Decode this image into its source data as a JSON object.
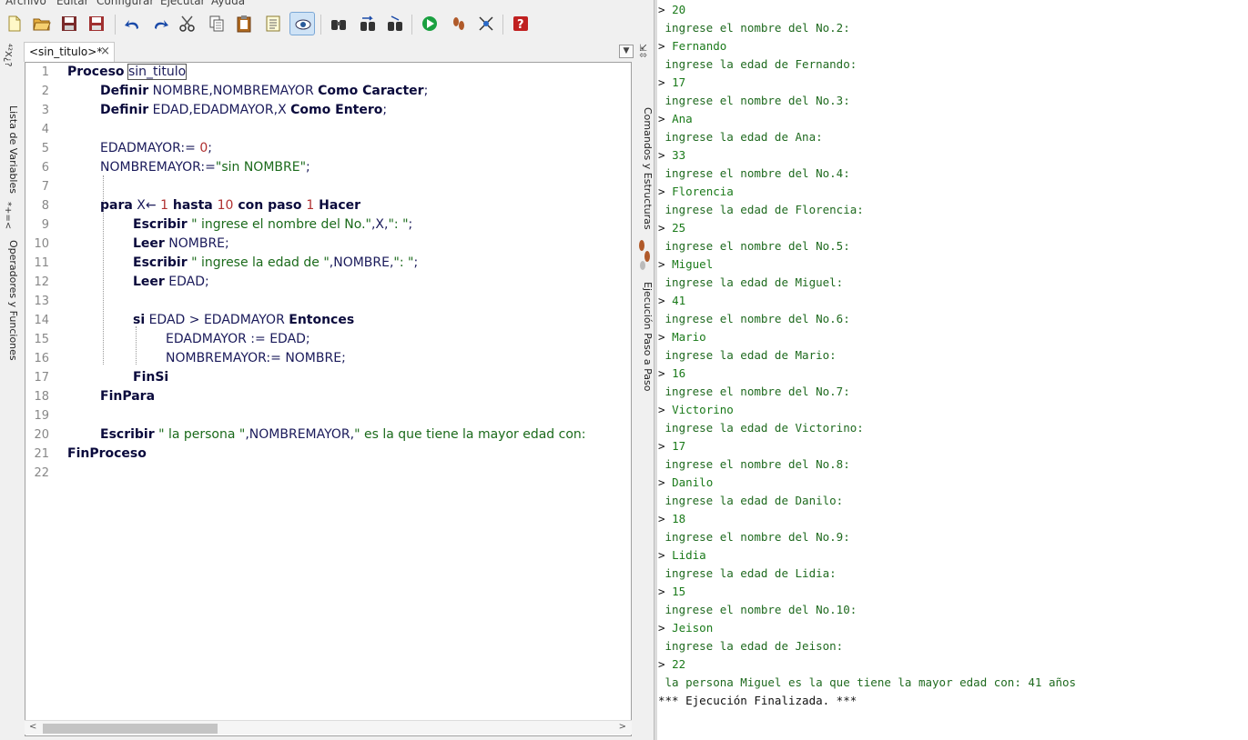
{
  "menu": [
    "Archivo",
    "Editar",
    "Configurar",
    "Ejecutar",
    "Ayuda"
  ],
  "toolbar": {
    "buttons": [
      "new-file-icon",
      "open-folder-icon",
      "save-icon",
      "save-as-icon",
      "undo-icon",
      "redo-icon",
      "cut-icon",
      "copy-icon",
      "paste-icon",
      "select-all-icon",
      "indent-icon",
      "find-icon",
      "find-next-icon",
      "replace-icon",
      "run-icon",
      "step-icon",
      "flowchart-icon",
      "help-icon"
    ]
  },
  "left_rail": {
    "variables_tab": "Lista de Variables",
    "operators_tab": "Operadores y Funciones"
  },
  "right_rail": {
    "commands_tab": "Comandos y Estructuras",
    "step_tab": "Ejecución Paso a Paso"
  },
  "editor": {
    "tab_label": "<sin_titulo>*",
    "tab_close": "×",
    "lines": [
      {
        "n": "1"
      },
      {
        "n": "2"
      },
      {
        "n": "3"
      },
      {
        "n": "4"
      },
      {
        "n": "5"
      },
      {
        "n": "6"
      },
      {
        "n": "7"
      },
      {
        "n": "8"
      },
      {
        "n": "9"
      },
      {
        "n": "10"
      },
      {
        "n": "11"
      },
      {
        "n": "12"
      },
      {
        "n": "13"
      },
      {
        "n": "14"
      },
      {
        "n": "15"
      },
      {
        "n": "16"
      },
      {
        "n": "17"
      },
      {
        "n": "18"
      },
      {
        "n": "19"
      },
      {
        "n": "20"
      },
      {
        "n": "21"
      },
      {
        "n": "22"
      }
    ],
    "code": {
      "l1_kw": "Proceso",
      "l1_name": "sin_titulo",
      "l2_kw": "Definir",
      "l2_vars": "NOMBRE,NOMBREMAYOR",
      "l2_kw2": "Como Caracter",
      "l2_end": ";",
      "l3_kw": "Definir",
      "l3_vars": "EDAD,EDADMAYOR,X",
      "l3_kw2": "Como Entero",
      "l3_end": ";",
      "l5_a": "EDADMAYOR:= ",
      "l5_num": "0",
      "l5_end": ";",
      "l6_a": "NOMBREMAYOR:=",
      "l6_str": "\"sin NOMBRE\"",
      "l6_end": ";",
      "l8_kw": "para",
      "l8_a": " X← ",
      "l8_n1": "1",
      "l8_kw2": " hasta ",
      "l8_n2": "10",
      "l8_kw3": " con paso ",
      "l8_n3": "1",
      "l8_kw4": " Hacer",
      "l9_kw": "Escribir",
      "l9_str": " \" ingrese el nombre del No.\"",
      "l9_a": ",X,",
      "l9_str2": "\": \"",
      "l9_end": ";",
      "l10_kw": "Leer",
      "l10_a": " NOMBRE;",
      "l11_kw": "Escribir",
      "l11_str": " \" ingrese la edad de \"",
      "l11_a": ",NOMBRE,",
      "l11_str2": "\": \"",
      "l11_end": ";",
      "l12_kw": "Leer",
      "l12_a": " EDAD;",
      "l14_kw": "si",
      "l14_a": " EDAD > EDADMAYOR ",
      "l14_kw2": "Entonces",
      "l15_a": "EDADMAYOR := EDAD;",
      "l16_a": "NOMBREMAYOR:= NOMBRE;",
      "l17_kw": "FinSi",
      "l18_kw": "FinPara",
      "l20_kw": "Escribir",
      "l20_str": " \" la persona \"",
      "l20_a": ",NOMBREMAYOR,",
      "l20_str2": "\" es la que tiene la mayor edad con:",
      "l21_kw": "FinProceso"
    }
  },
  "console": {
    "lines": [
      {
        "type": "in",
        "text": "20"
      },
      {
        "type": "out",
        "text": " ingrese el nombre del No.2:"
      },
      {
        "type": "in",
        "text": "Fernando"
      },
      {
        "type": "out",
        "text": " ingrese la edad de Fernando:"
      },
      {
        "type": "in",
        "text": "17"
      },
      {
        "type": "out",
        "text": " ingrese el nombre del No.3:"
      },
      {
        "type": "in",
        "text": "Ana"
      },
      {
        "type": "out",
        "text": " ingrese la edad de Ana:"
      },
      {
        "type": "in",
        "text": "33"
      },
      {
        "type": "out",
        "text": " ingrese el nombre del No.4:"
      },
      {
        "type": "in",
        "text": "Florencia"
      },
      {
        "type": "out",
        "text": " ingrese la edad de Florencia:"
      },
      {
        "type": "in",
        "text": "25"
      },
      {
        "type": "out",
        "text": " ingrese el nombre del No.5:"
      },
      {
        "type": "in",
        "text": "Miguel"
      },
      {
        "type": "out",
        "text": " ingrese la edad de Miguel:"
      },
      {
        "type": "in",
        "text": "41"
      },
      {
        "type": "out",
        "text": " ingrese el nombre del No.6:"
      },
      {
        "type": "in",
        "text": "Mario"
      },
      {
        "type": "out",
        "text": " ingrese la edad de Mario:"
      },
      {
        "type": "in",
        "text": "16"
      },
      {
        "type": "out",
        "text": " ingrese el nombre del No.7:"
      },
      {
        "type": "in",
        "text": "Victorino"
      },
      {
        "type": "out",
        "text": " ingrese la edad de Victorino:"
      },
      {
        "type": "in",
        "text": "17"
      },
      {
        "type": "out",
        "text": " ingrese el nombre del No.8:"
      },
      {
        "type": "in",
        "text": "Danilo"
      },
      {
        "type": "out",
        "text": " ingrese la edad de Danilo:"
      },
      {
        "type": "in",
        "text": "18"
      },
      {
        "type": "out",
        "text": " ingrese el nombre del No.9:"
      },
      {
        "type": "in",
        "text": "Lidia"
      },
      {
        "type": "out",
        "text": " ingrese la edad de Lidia:"
      },
      {
        "type": "in",
        "text": "15"
      },
      {
        "type": "out",
        "text": " ingrese el nombre del No.10:"
      },
      {
        "type": "in",
        "text": "Jeison"
      },
      {
        "type": "out",
        "text": " ingrese la edad de Jeison:"
      },
      {
        "type": "in",
        "text": "22"
      },
      {
        "type": "out",
        "text": " la persona Miguel es la que tiene la mayor edad con: 41 años"
      },
      {
        "type": "fin",
        "text": "*** Ejecución Finalizada. ***"
      }
    ],
    "prompt": ">"
  }
}
